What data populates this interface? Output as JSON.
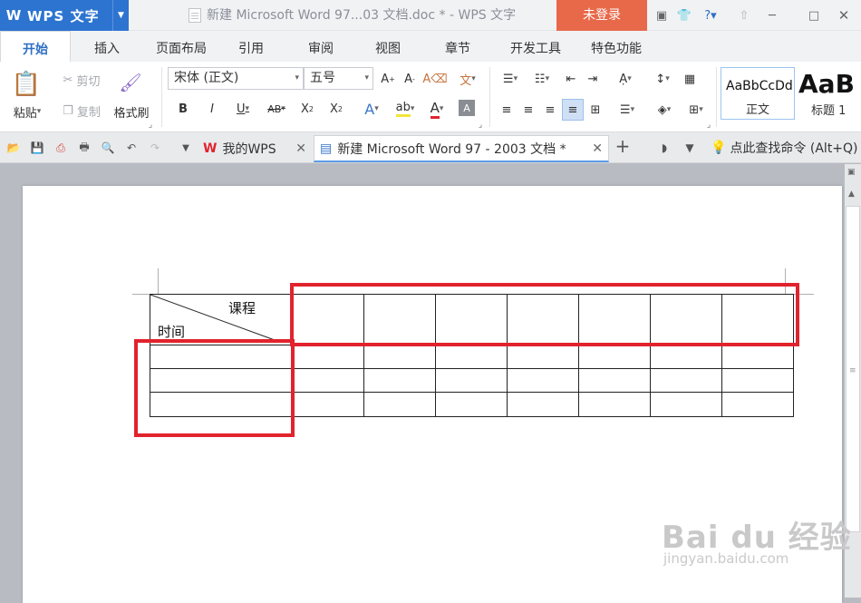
{
  "titlebar": {
    "app_logo": "W",
    "app_name": "WPS 文字",
    "window_title": "新建 Microsoft Word 97...03 文档.doc * - WPS 文字",
    "login_label": "未登录"
  },
  "ribbon_tabs": [
    "开始",
    "插入",
    "页面布局",
    "引用",
    "审阅",
    "视图",
    "章节",
    "开发工具",
    "特色功能"
  ],
  "ribbon": {
    "paste_label": "粘贴",
    "cut_label": "剪切",
    "copy_label": "复制",
    "format_painter_label": "格式刷",
    "font_name": "宋体 (正文)",
    "font_size": "五号",
    "styles": [
      {
        "preview": "AaBbCcDd",
        "label": "正文"
      },
      {
        "preview": "AaB",
        "label": "标题 1"
      }
    ]
  },
  "doc_tabs": [
    {
      "label": "我的WPS",
      "active": false
    },
    {
      "label": "新建 Microsoft Word 97 - 2003 文档 *",
      "active": true
    }
  ],
  "search_command": "点此查找命令 (Alt+Q)",
  "table": {
    "header_top_label": "课程",
    "header_bottom_label": "时间",
    "columns": 8,
    "rows": 4
  },
  "watermark": {
    "brand": "Bai du 经验",
    "url": "jingyan.baidu.com"
  }
}
